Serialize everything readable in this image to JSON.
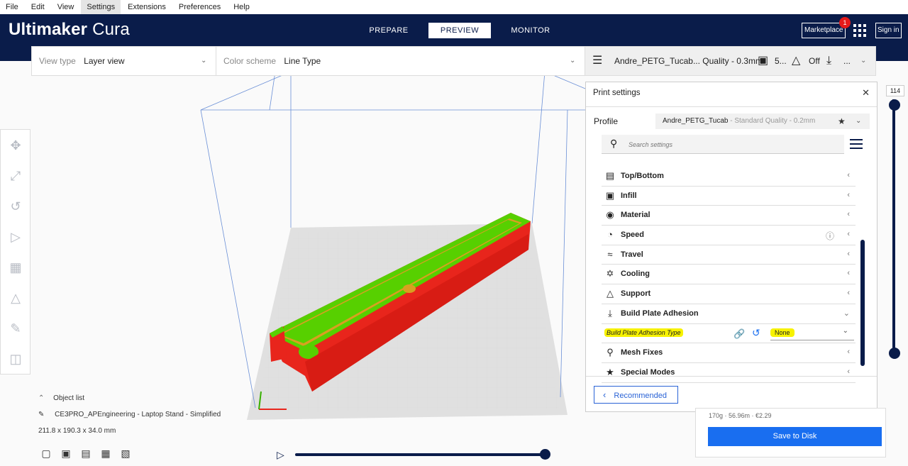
{
  "menu": [
    "File",
    "Edit",
    "View",
    "Settings",
    "Extensions",
    "Preferences",
    "Help"
  ],
  "menu_active": "Settings",
  "header": {
    "brand_bold": "Ultimaker",
    "brand_light": "Cura",
    "tabs": [
      "PREPARE",
      "PREVIEW",
      "MONITOR"
    ],
    "active_tab": "PREVIEW",
    "marketplace": "Marketplace",
    "marketplace_badge": "1",
    "signin": "Sign in"
  },
  "viewbar": {
    "view_type_label": "View type",
    "view_type_value": "Layer view",
    "color_scheme_label": "Color scheme",
    "color_scheme_value": "Line Type"
  },
  "printbar": {
    "profile": "Andre_PETG_Tucab... Quality - 0.3mm",
    "infill": "5...",
    "support": "Off",
    "adhesion": "..."
  },
  "panel": {
    "title": "Print settings",
    "profile_label": "Profile",
    "profile_name": "Andre_PETG_Tucab",
    "profile_quality": " - Standard Quality - 0.2mm",
    "search_placeholder": "Search settings",
    "categories": [
      {
        "label": "Top/Bottom",
        "icon": "top-bottom-icon"
      },
      {
        "label": "Infill",
        "icon": "infill-icon"
      },
      {
        "label": "Material",
        "icon": "material-icon"
      },
      {
        "label": "Speed",
        "icon": "speed-icon"
      },
      {
        "label": "Travel",
        "icon": "travel-icon"
      },
      {
        "label": "Cooling",
        "icon": "cooling-icon"
      },
      {
        "label": "Support",
        "icon": "support-icon"
      },
      {
        "label": "Build Plate Adhesion",
        "icon": "adhesion-icon"
      },
      {
        "label": "Mesh Fixes",
        "icon": "mesh-fixes-icon"
      },
      {
        "label": "Special Modes",
        "icon": "special-modes-icon"
      }
    ],
    "adhesion_setting_label": "Build Plate Adhesion Type",
    "adhesion_setting_value": "None",
    "recommended": "Recommended"
  },
  "action": {
    "estimate": "170g · 56.96m · €2.29",
    "save": "Save to Disk"
  },
  "objects": {
    "title": "Object list",
    "name": "CE3PRO_APEngineering - Laptop Stand - Simplified",
    "dims": "211.8 x 190.3 x 34.0 mm"
  },
  "layer_number": "114",
  "colors": {
    "navy": "#0a1c4a",
    "accent_blue": "#196ef0",
    "highlight_yellow": "#f7f200",
    "wall_red": "#e8251c",
    "skin_green": "#57d000"
  }
}
